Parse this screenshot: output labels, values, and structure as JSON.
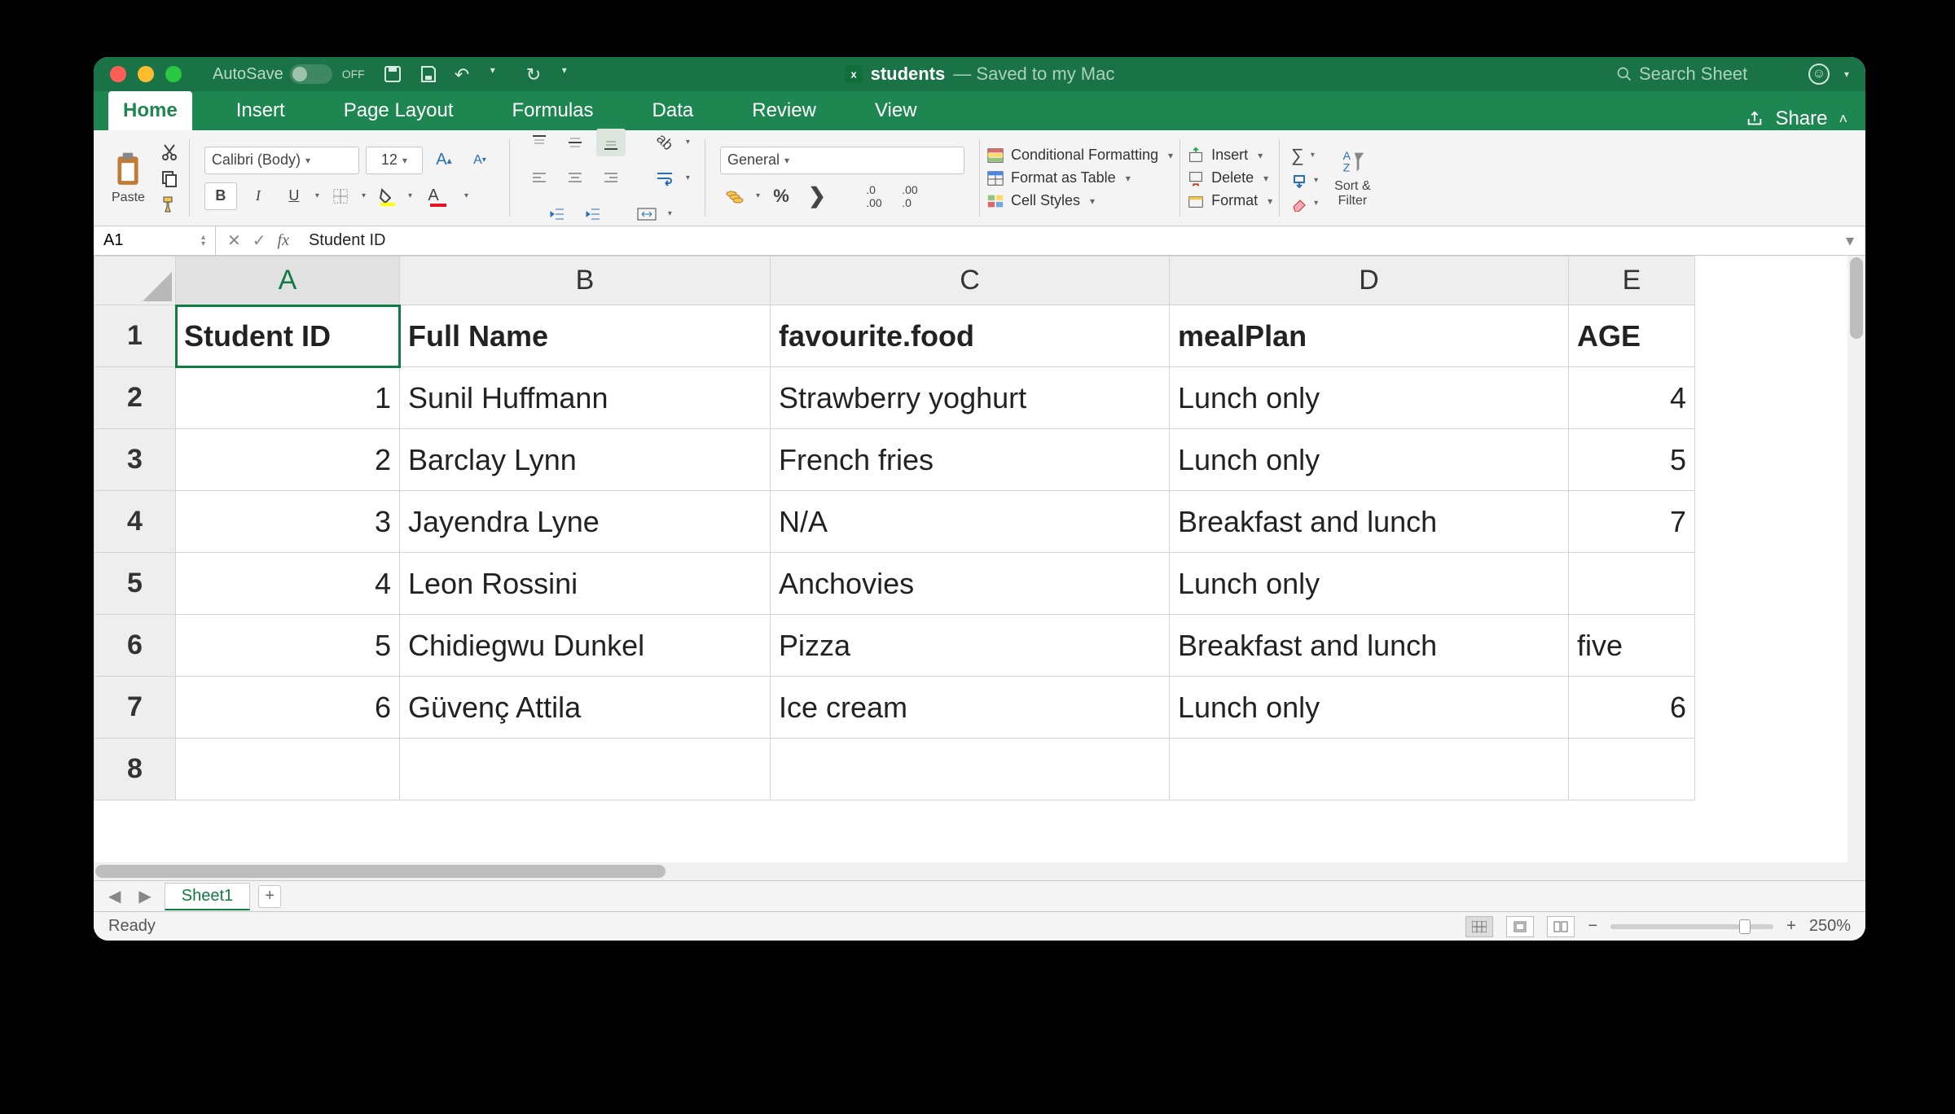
{
  "titlebar": {
    "autosave_label": "AutoSave",
    "autosave_state": "OFF",
    "filename": "students",
    "saved_text": "— Saved to my Mac",
    "search_placeholder": "Search Sheet"
  },
  "tabs": {
    "items": [
      "Home",
      "Insert",
      "Page Layout",
      "Formulas",
      "Data",
      "Review",
      "View"
    ],
    "active": "Home",
    "share": "Share"
  },
  "ribbon": {
    "paste": "Paste",
    "font_name": "Calibri (Body)",
    "font_size": "12",
    "number_format": "General",
    "cond_fmt": "Conditional Formatting",
    "fmt_table": "Format as Table",
    "cell_styles": "Cell Styles",
    "insert": "Insert",
    "delete": "Delete",
    "format": "Format",
    "sort_filter": "Sort &\nFilter"
  },
  "formula_bar": {
    "cell_ref": "A1",
    "content": "Student ID"
  },
  "sheet": {
    "columns": [
      "A",
      "B",
      "C",
      "D",
      "E"
    ],
    "active_col": "A",
    "visible_rows": 8,
    "data": [
      [
        "Student ID",
        "Full Name",
        "favourite.food",
        "mealPlan",
        "AGE"
      ],
      [
        "1",
        "Sunil Huffmann",
        "Strawberry yoghurt",
        "Lunch only",
        "4"
      ],
      [
        "2",
        "Barclay Lynn",
        "French fries",
        "Lunch only",
        "5"
      ],
      [
        "3",
        "Jayendra Lyne",
        "N/A",
        "Breakfast and lunch",
        "7"
      ],
      [
        "4",
        "Leon Rossini",
        "Anchovies",
        "Lunch only",
        ""
      ],
      [
        "5",
        "Chidiegwu Dunkel",
        "Pizza",
        "Breakfast and lunch",
        "five"
      ],
      [
        "6",
        "Güvenç Attila",
        "Ice cream",
        "Lunch only",
        "6"
      ]
    ],
    "numeric_right_cols": [
      0,
      4
    ]
  },
  "sheet_tabs": {
    "active": "Sheet1"
  },
  "status": {
    "text": "Ready",
    "zoom": "250%"
  }
}
